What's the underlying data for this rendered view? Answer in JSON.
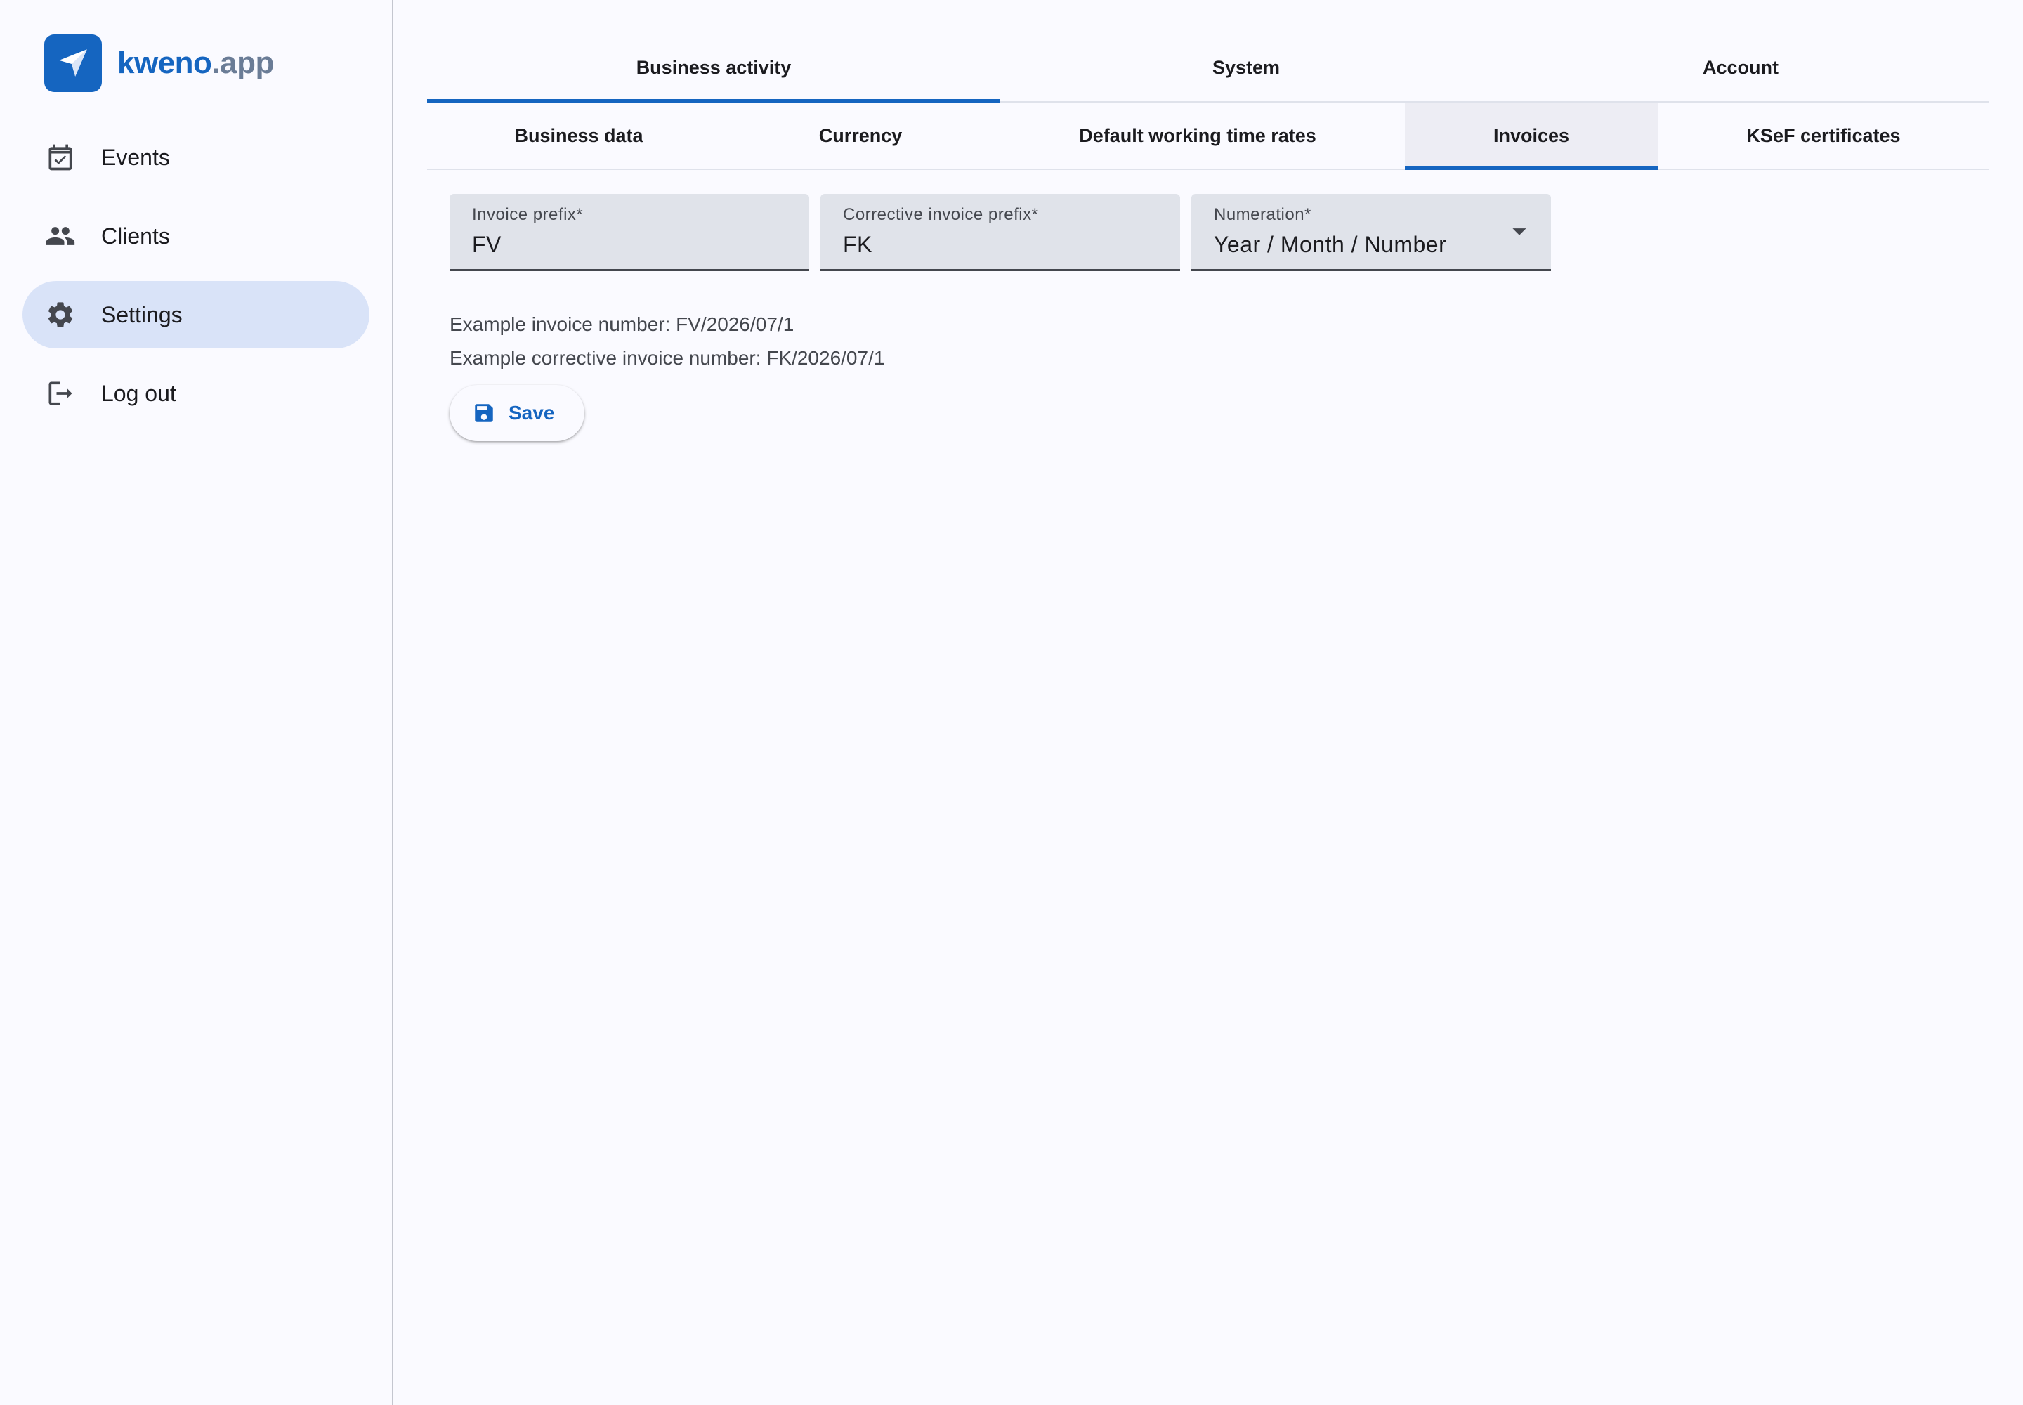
{
  "brand": {
    "name": "kweno",
    "domain": ".app",
    "logo_icon": "paper-plane-icon"
  },
  "sidebar": {
    "items": [
      {
        "label": "Events",
        "icon": "calendar-check-icon",
        "active": false
      },
      {
        "label": "Clients",
        "icon": "people-icon",
        "active": false
      },
      {
        "label": "Settings",
        "icon": "gear-icon",
        "active": true
      },
      {
        "label": "Log out",
        "icon": "logout-icon",
        "active": false
      }
    ]
  },
  "tabs_primary": {
    "items": [
      {
        "label": "Business activity",
        "active": true
      },
      {
        "label": "System",
        "active": false
      },
      {
        "label": "Account",
        "active": false
      }
    ]
  },
  "tabs_secondary": {
    "items": [
      {
        "label": "Business data",
        "active": false
      },
      {
        "label": "Currency",
        "active": false
      },
      {
        "label": "Default working time rates",
        "active": false
      },
      {
        "label": "Invoices",
        "active": true
      },
      {
        "label": "KSeF certificates",
        "active": false
      }
    ]
  },
  "form": {
    "invoice_prefix": {
      "label": "Invoice prefix*",
      "value": "FV"
    },
    "corrective_prefix": {
      "label": "Corrective invoice prefix*",
      "value": "FK"
    },
    "numeration": {
      "label": "Numeration*",
      "value": "Year / Month / Number"
    },
    "example_invoice": "Example invoice number: FV/2026/07/1",
    "example_corrective": "Example corrective invoice number: FK/2026/07/1",
    "save_label": "Save"
  },
  "colors": {
    "accent": "#1565c0",
    "active_nav_bg": "#d9e3f8",
    "field_bg": "#e0e3ea",
    "page_bg": "#fafaff"
  }
}
